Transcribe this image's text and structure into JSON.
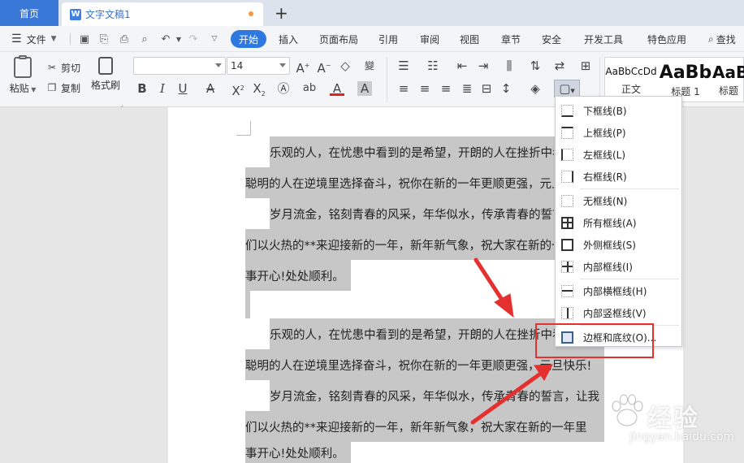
{
  "tabs": {
    "home_label": "首页",
    "doc_label": "文字文稿1",
    "doc_icon_letter": "W",
    "new_tab_glyph": "+"
  },
  "menubar": {
    "file_label": "文件",
    "items": [
      "开始",
      "插入",
      "页面布局",
      "引用",
      "审阅",
      "视图",
      "章节",
      "安全",
      "开发工具",
      "特色应用"
    ],
    "active_item": "开始",
    "search_label": "查找"
  },
  "ribbon": {
    "paste_label": "粘贴",
    "cut_label": "剪切",
    "copy_label": "复制",
    "format_painter_label": "格式刷",
    "font_name_value": "",
    "font_size_value": "14",
    "styles": [
      {
        "sample": "AaBbCcDd",
        "name": "正文"
      },
      {
        "sample": "AaBb",
        "name": "标题 1"
      },
      {
        "sample": "AaB",
        "name": "标题"
      }
    ]
  },
  "document": {
    "lines": [
      "乐观的人，在忧患中看到的是希望，开朗的人在挫折中看到",
      "聪明的人在逆境里选择奋斗，祝你在新的一年更顺更强，元旦快乐!",
      "岁月流金，铭刻青春的风采，年华似水，传承青春的誓言，让我",
      "们以火热的**来迎接新的一年，新年新气象，祝大家在新的一年里",
      "事开心!处处顺利。",
      "乐观的人，在忧患中看到的是希望，开朗的人在挫折中看到",
      "聪明的人在逆境里选择奋斗，祝你在新的一年更顺更强，元旦快乐!",
      "岁月流金，铭刻青春的风采，年华似水，传承青春的誓言，让我",
      "们以火热的**来迎接新的一年，新年新气象，祝大家在新的一年里",
      "事开心!处处顺利。"
    ]
  },
  "border_menu": {
    "items": [
      {
        "label": "下框线(B)",
        "icon": "border-bottom-icon"
      },
      {
        "label": "上框线(P)",
        "icon": "border-top-icon"
      },
      {
        "label": "左框线(L)",
        "icon": "border-left-icon"
      },
      {
        "label": "右框线(R)",
        "icon": "border-right-icon"
      },
      {
        "label": "无框线(N)",
        "icon": "border-none-icon"
      },
      {
        "label": "所有框线(A)",
        "icon": "border-all-icon"
      },
      {
        "label": "外侧框线(S)",
        "icon": "border-outside-icon"
      },
      {
        "label": "内部框线(I)",
        "icon": "border-inside-icon"
      },
      {
        "label": "内部横框线(H)",
        "icon": "border-inside-horizontal-icon"
      },
      {
        "label": "内部竖框线(V)",
        "icon": "border-inside-vertical-icon"
      },
      {
        "label": "边框和底纹(O)...",
        "icon": "borders-and-shading-icon"
      }
    ]
  },
  "watermark": {
    "text": "经验",
    "url": "jingyan.baidu.com"
  },
  "colors": {
    "accent": "#2f78e0",
    "home_tab": "#3a78d8",
    "selection": "#c7c7c7",
    "highlight": "#e53030"
  }
}
